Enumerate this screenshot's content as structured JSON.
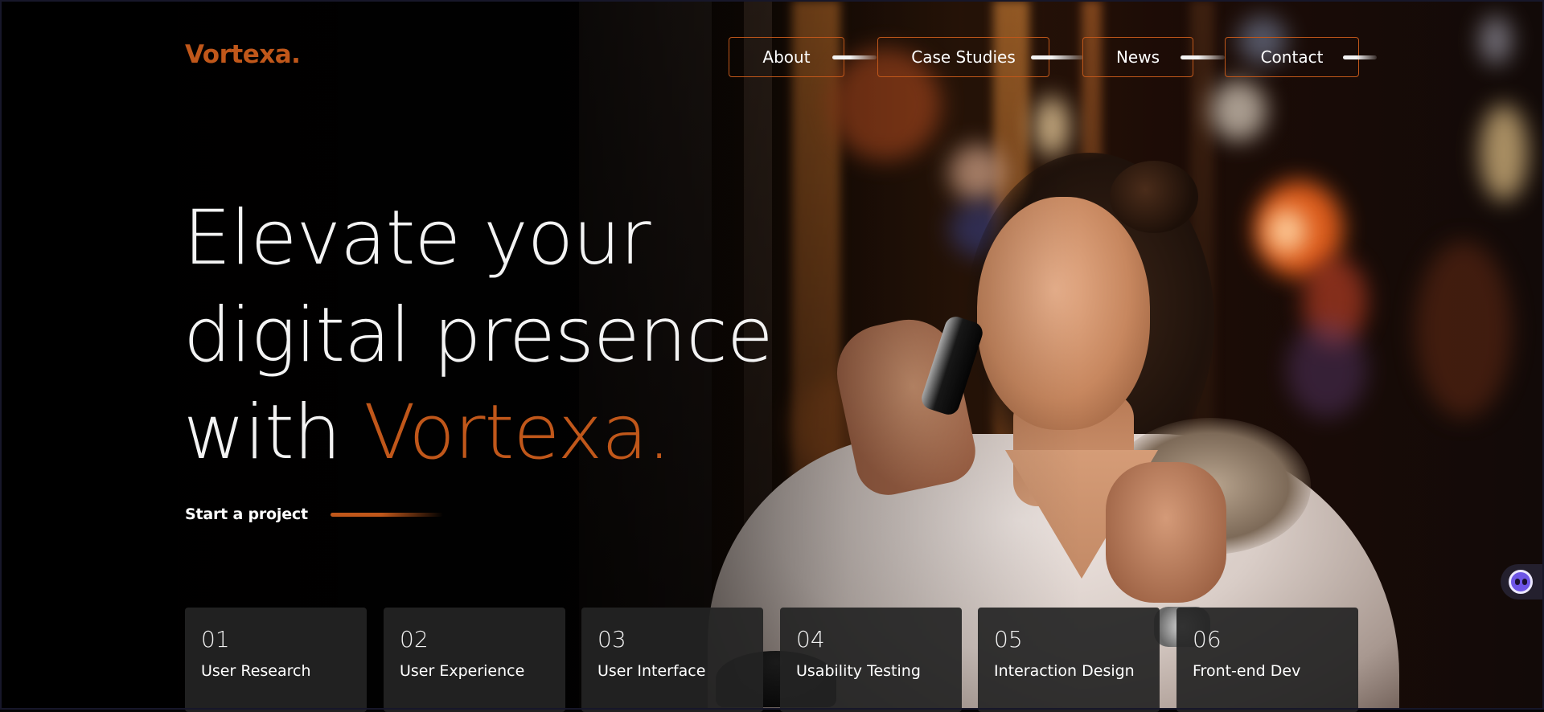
{
  "brand": {
    "logo": "Vortexa.",
    "accent_color": "#c0571a"
  },
  "nav": {
    "items": [
      {
        "label": "About"
      },
      {
        "label": "Case Studies"
      },
      {
        "label": "News"
      },
      {
        "label": "Contact"
      }
    ]
  },
  "hero": {
    "headline_line1": "Elevate your",
    "headline_line2": "digital presence",
    "headline_line3_prefix": "with ",
    "headline_line3_accent": "Vortexa.",
    "cta_label": "Start a project",
    "background": "night-bokeh-photo-woman-on-phone"
  },
  "services": [
    {
      "number": "01",
      "title": "User Research"
    },
    {
      "number": "02",
      "title": "User Experience"
    },
    {
      "number": "03",
      "title": "User Interface"
    },
    {
      "number": "04",
      "title": "Usability Testing"
    },
    {
      "number": "05",
      "title": "Interaction Design"
    },
    {
      "number": "06",
      "title": "Front-end Dev"
    }
  ],
  "widget": {
    "icon": "chat-assistant-icon"
  }
}
